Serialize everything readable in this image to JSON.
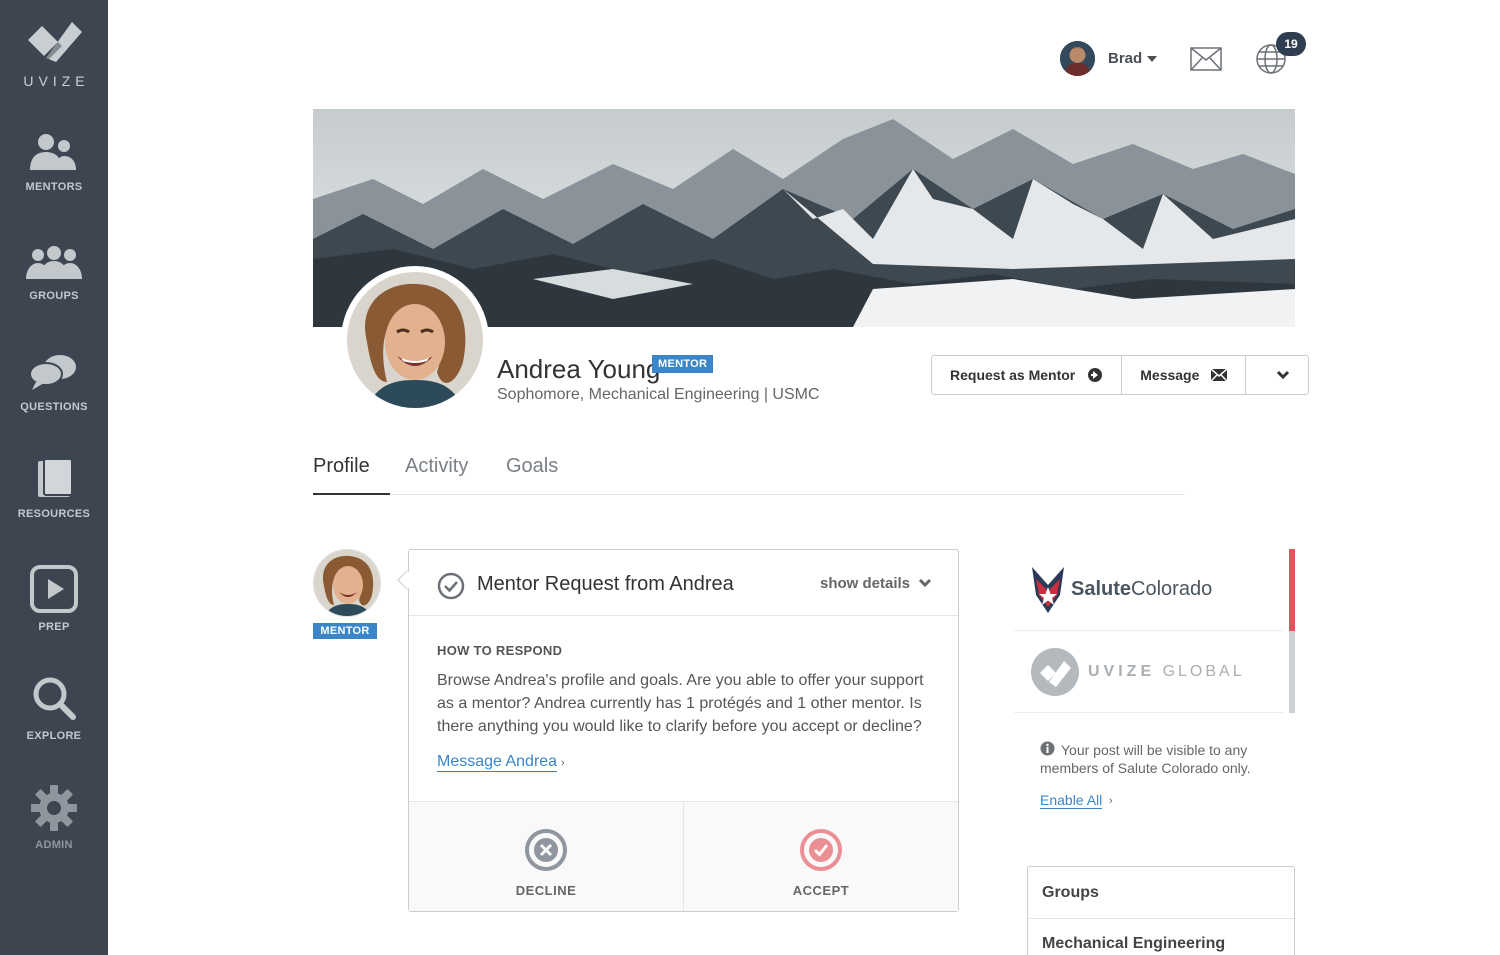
{
  "app": {
    "logo_text": "UVIZE"
  },
  "sidebar": {
    "items": [
      {
        "label": "MENTORS",
        "icon": "mentors-icon"
      },
      {
        "label": "GROUPS",
        "icon": "groups-icon"
      },
      {
        "label": "QUESTIONS",
        "icon": "questions-icon"
      },
      {
        "label": "RESOURCES",
        "icon": "resources-icon"
      },
      {
        "label": "PREP",
        "icon": "play-icon"
      },
      {
        "label": "EXPLORE",
        "icon": "search-icon"
      },
      {
        "label": "ADMIN",
        "icon": "gear-icon"
      }
    ]
  },
  "topbar": {
    "user_name": "Brad",
    "notification_count": "19"
  },
  "profile": {
    "name": "Andrea Young",
    "role_badge": "MENTOR",
    "subtitle": "Sophomore, Mechanical Engineering | USMC",
    "actions": {
      "request_mentor": "Request as Mentor",
      "message": "Message"
    }
  },
  "tabs": [
    {
      "label": "Profile",
      "active": true
    },
    {
      "label": "Activity",
      "active": false
    },
    {
      "label": "Goals",
      "active": false
    }
  ],
  "request_card": {
    "avatar_badge": "MENTOR",
    "title": "Mentor Request from Andrea",
    "show_details": "show details",
    "how_heading": "HOW TO RESPOND",
    "body": "Browse Andrea's profile and goals. Are you able to offer your support as a mentor? Andrea currently has 1 protégés and 1 other mentor. Is there anything you would like to clarify before you accept or decline?",
    "message_link": "Message Andrea",
    "decline_label": "DECLINE",
    "accept_label": "ACCEPT"
  },
  "right_panel": {
    "org1_name_bold": "Salute",
    "org1_name_rest": "Colorado",
    "org2_name_bold": "UVIZE",
    "org2_name_rest": "GLOBAL",
    "notice": "Your post will be visible to any members of Salute Colorado only.",
    "enable_all": "Enable All"
  },
  "groups": {
    "title": "Groups",
    "items": [
      "Mechanical Engineering"
    ]
  },
  "colors": {
    "sidebar_bg": "#3d4650",
    "accent_blue": "#3a86c8",
    "accept_red": "#e0555d",
    "badge_dark": "#2e3e50"
  }
}
